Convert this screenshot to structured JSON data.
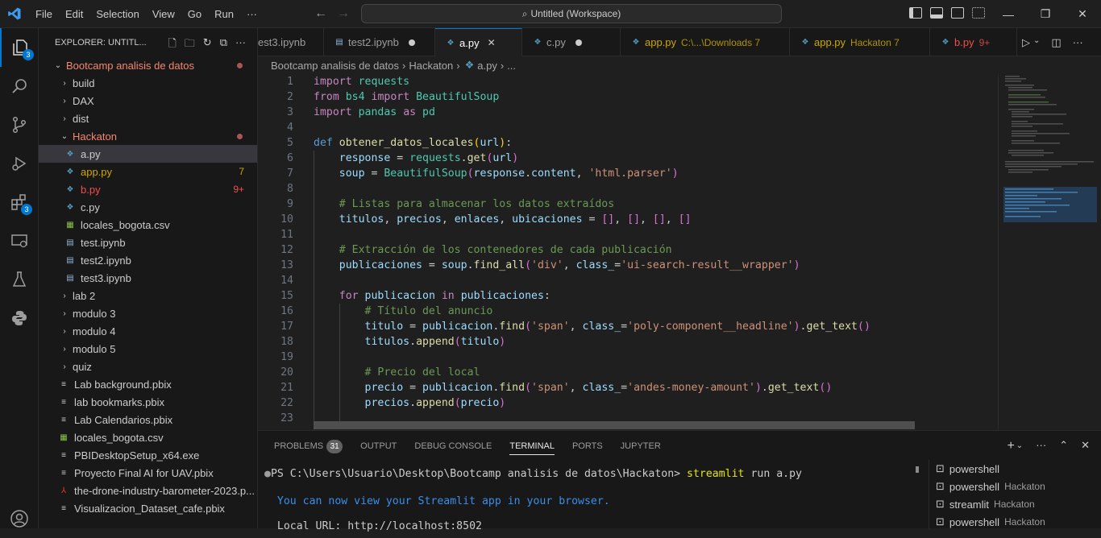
{
  "menu": [
    "File",
    "Edit",
    "Selection",
    "View",
    "Go",
    "Run",
    "···"
  ],
  "command_center": "Untitled (Workspace)",
  "activity_badges": {
    "explorer": "3",
    "extensions": "3"
  },
  "explorer": {
    "title": "EXPLORER: UNTITL...",
    "root": "Bootcamp analisis de datos",
    "items": [
      {
        "label": "build",
        "type": "folder"
      },
      {
        "label": "DAX",
        "type": "folder"
      },
      {
        "label": "dist",
        "type": "folder"
      },
      {
        "label": "Hackaton",
        "type": "folder-open"
      },
      {
        "label": "a.py",
        "type": "py",
        "selected": true
      },
      {
        "label": "app.py",
        "type": "py",
        "badge": "7",
        "color": "#cca700"
      },
      {
        "label": "b.py",
        "type": "py",
        "badge": "9+",
        "color": "#f14c4c"
      },
      {
        "label": "c.py",
        "type": "py"
      },
      {
        "label": "locales_bogota.csv",
        "type": "csv"
      },
      {
        "label": "test.ipynb",
        "type": "nb"
      },
      {
        "label": "test2.ipynb",
        "type": "nb"
      },
      {
        "label": "test3.ipynb",
        "type": "nb"
      },
      {
        "label": "lab 2",
        "type": "folder"
      },
      {
        "label": "modulo 3",
        "type": "folder"
      },
      {
        "label": "modulo 4",
        "type": "folder"
      },
      {
        "label": "modulo 5",
        "type": "folder"
      },
      {
        "label": "quiz",
        "type": "folder"
      },
      {
        "label": "Lab background.pbix",
        "type": "file"
      },
      {
        "label": "lab bookmarks.pbix",
        "type": "file"
      },
      {
        "label": "Lab Calendarios.pbix",
        "type": "file"
      },
      {
        "label": "locales_bogota.csv",
        "type": "csv"
      },
      {
        "label": "PBIDesktopSetup_x64.exe",
        "type": "file"
      },
      {
        "label": "Proyecto Final AI for UAV.pbix",
        "type": "file"
      },
      {
        "label": "the-drone-industry-barometer-2023.p...",
        "type": "pdf"
      },
      {
        "label": "Visualizacion_Dataset_cafe.pbix",
        "type": "file"
      }
    ]
  },
  "tabs": [
    {
      "label": "est3.ipynb",
      "type": "nb"
    },
    {
      "label": "test2.ipynb",
      "type": "nb",
      "dot": true
    },
    {
      "label": "a.py",
      "type": "py",
      "active": true
    },
    {
      "label": "c.py",
      "type": "py",
      "dot": true
    },
    {
      "label": "app.py",
      "desc": "C:\\...\\Downloads 7",
      "type": "py",
      "color": "#cca700"
    },
    {
      "label": "app.py",
      "desc": "Hackaton 7",
      "type": "py",
      "color": "#cca700"
    },
    {
      "label": "b.py",
      "desc": "9+",
      "type": "py",
      "color": "#f14c4c"
    }
  ],
  "breadcrumb": [
    "Bootcamp analisis de datos",
    "Hackaton",
    "a.py",
    "..."
  ],
  "code_lines": [
    "1",
    "2",
    "3",
    "4",
    "5",
    "6",
    "7",
    "8",
    "9",
    "10",
    "11",
    "12",
    "13",
    "14",
    "15",
    "16",
    "17",
    "18",
    "19",
    "20",
    "21",
    "22",
    "23"
  ],
  "panel": {
    "tabs": [
      "PROBLEMS",
      "OUTPUT",
      "DEBUG CONSOLE",
      "TERMINAL",
      "PORTS",
      "JUPYTER"
    ],
    "problems_count": "31",
    "terminal": {
      "prompt": "PS C:\\Users\\Usuario\\Desktop\\Bootcamp analisis de datos\\Hackaton> ",
      "command": "streamlit",
      "args": " run a.py",
      "message": "  You can now view your Streamlit app in your browser.",
      "url_line": "  Local URL: http://localhost:8502"
    },
    "terminals": [
      {
        "name": "powershell",
        "sub": ""
      },
      {
        "name": "powershell",
        "sub": "Hackaton"
      },
      {
        "name": "streamlit",
        "sub": "Hackaton"
      },
      {
        "name": "powershell",
        "sub": "Hackaton"
      }
    ]
  }
}
